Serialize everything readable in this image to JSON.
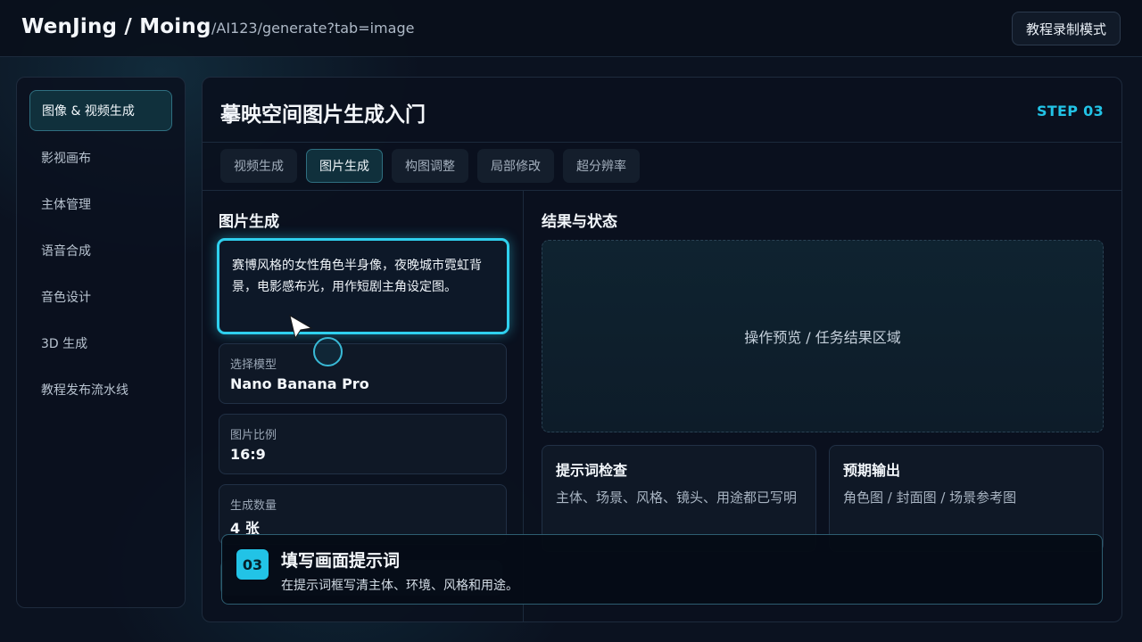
{
  "header": {
    "brand": "WenJing / Moing",
    "path": "/AI123/generate?tab=image",
    "record_button": "教程录制模式"
  },
  "sidebar": {
    "items": [
      {
        "label": "图像 & 视频生成",
        "active": true
      },
      {
        "label": "影视画布"
      },
      {
        "label": "主体管理"
      },
      {
        "label": "语音合成"
      },
      {
        "label": "音色设计"
      },
      {
        "label": "3D 生成"
      },
      {
        "label": "教程发布流水线"
      }
    ]
  },
  "main": {
    "title": "摹映空间图片生成入门",
    "step": "STEP 03",
    "tabs": [
      {
        "label": "视频生成"
      },
      {
        "label": "图片生成",
        "active": true
      },
      {
        "label": "构图调整"
      },
      {
        "label": "局部修改"
      },
      {
        "label": "超分辨率"
      }
    ],
    "left": {
      "title": "图片生成",
      "prompt": "赛博风格的女性角色半身像，夜晚城市霓虹背景，电影感布光，用作短剧主角设定图。",
      "fields": [
        {
          "label": "选择模型",
          "value": "Nano Banana Pro"
        },
        {
          "label": "图片比例",
          "value": "16:9"
        },
        {
          "label": "生成数量",
          "value": "4 张"
        }
      ]
    },
    "right": {
      "title": "结果与状态",
      "preview_text": "操作预览 / 任务结果区域",
      "cards": [
        {
          "title": "提示词检查",
          "text": "主体、场景、风格、镜头、用途都已写明"
        },
        {
          "title": "预期输出",
          "text": "角色图 / 封面图 / 场景参考图"
        }
      ]
    }
  },
  "overlay": {
    "badge": "03",
    "title": "填写画面提示词",
    "text": "在提示词框写清主体、环境、风格和用途。"
  },
  "colors": {
    "accent": "#22c3e6",
    "background": "#0b1220",
    "active_bg": "#10303c"
  }
}
